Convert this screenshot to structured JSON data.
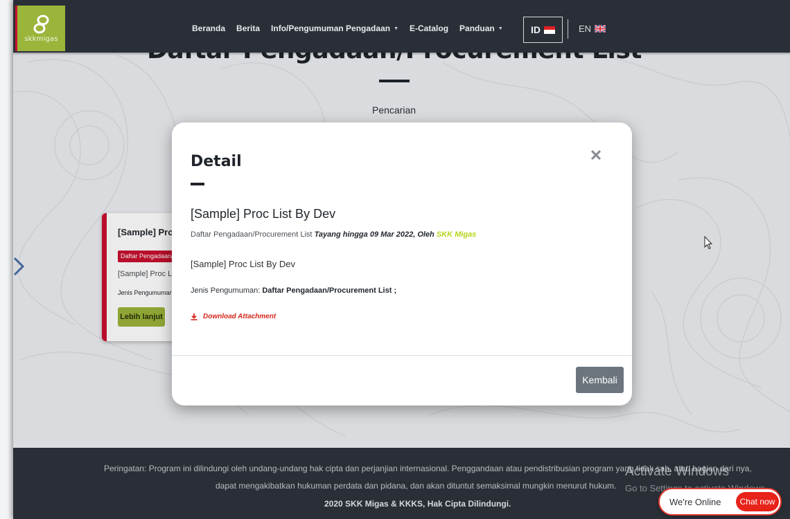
{
  "brand": {
    "logo_text": "skkmigas",
    "accent_red": "#c8102e",
    "accent_green": "#9bb43a"
  },
  "nav": {
    "items": [
      {
        "label": "Beranda",
        "has_caret": false
      },
      {
        "label": "Berita",
        "has_caret": false
      },
      {
        "label": "Info/Pengumuman Pengadaan",
        "has_caret": true
      },
      {
        "label": "E-Catalog",
        "has_caret": false
      },
      {
        "label": "Panduan",
        "has_caret": true
      }
    ],
    "lang_id": "ID",
    "lang_en": "EN"
  },
  "page": {
    "title": "Daftar Pengadaan/Procurement List",
    "search_label": "Pencarian"
  },
  "card": {
    "title": "[Sample] Proc",
    "badge": "Daftar Pengadaan/",
    "line": "[Sample] Proc Lis",
    "meta": "Jenis Pengumuman",
    "button": "Lebih lanjut"
  },
  "modal": {
    "title": "Detail",
    "heading": "[Sample] Proc List By Dev",
    "sub_category": "Daftar Pengadaan/Procurement List",
    "sub_date": "Tayang hingga 09 Mar 2022, Oleh",
    "sub_org": "SKK Migas",
    "body": "[Sample] Proc List By Dev",
    "jenis_label": "Jenis Pengumuman:",
    "jenis_value": "Daftar Pengadaan/Procurement List ;",
    "download_label": "Download Attachment",
    "back_button": "Kembali"
  },
  "footer": {
    "line1": "Peringatan: Program ini dilindungi oleh undang-undang hak cipta dan perjanjian internasional. Penggandaan atau pendistribusian program yang tidak sah, atau bagian dari nya,",
    "line2": "dapat mengakibatkan hukuman perdata dan pidana, dan akan dituntut semaksimal mungkin menurut hukum.",
    "copyright": "2020 SKK Migas & KKKS, Hak Cipta Dilindungi."
  },
  "windows_watermark": {
    "title": "Activate Windows",
    "subtitle": "Go to Settings to activate Windows."
  },
  "chat": {
    "status": "We're Online",
    "button": "Chat now"
  }
}
